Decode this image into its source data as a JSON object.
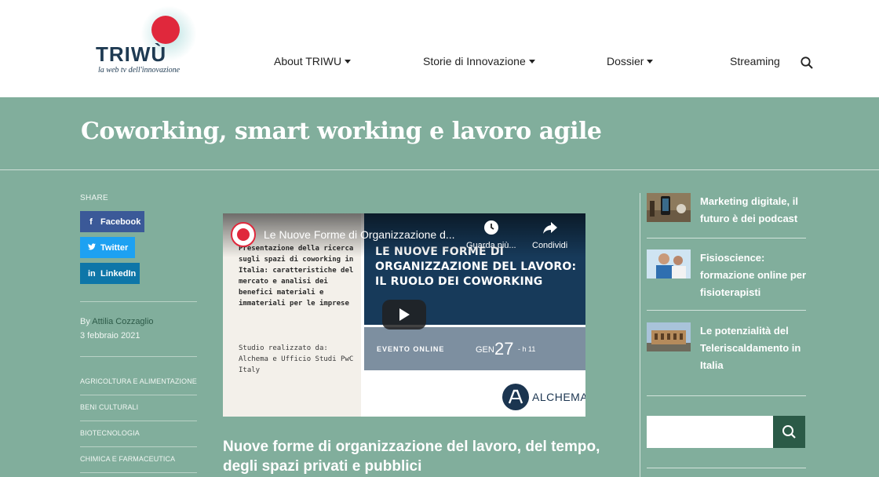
{
  "brand": {
    "name": "TRIWÙ",
    "tagline": "la web tv dell'innovazione"
  },
  "nav": {
    "items": [
      {
        "label": "About TRIWU",
        "has_dropdown": true
      },
      {
        "label": "Storie di Innovazione",
        "has_dropdown": true
      },
      {
        "label": "Dossier",
        "has_dropdown": true
      },
      {
        "label": "Streaming",
        "has_dropdown": false
      }
    ],
    "search_icon": "search-icon"
  },
  "page": {
    "title": "Coworking, smart working e lavoro agile"
  },
  "share": {
    "label": "SHARE",
    "buttons": [
      {
        "label": "Facebook",
        "icon": "f",
        "color": "#3b5998"
      },
      {
        "label": "Twitter",
        "icon": "twitter-icon",
        "color": "#1da1f2"
      },
      {
        "label": "LinkedIn",
        "icon": "in",
        "color": "#0e76a8"
      }
    ]
  },
  "meta": {
    "by": "By",
    "author": "Attilia Cozzaglio",
    "date": "3 febbraio 2021"
  },
  "categories": [
    "AGRICOLTURA E ALIMENTAZIONE",
    "BENI CULTURALI",
    "BIOTECNOLOGIA",
    "CHIMICA E FARMACEUTICA"
  ],
  "video": {
    "title": "Le Nuove Forme di Organizzazione d...",
    "watch_later": "Guarda più...",
    "share": "Condividi",
    "slide_left_text": "Presentazione della ricerca sugli spazi di coworking in Italia: caratteristiche del mercato e analisi dei benefici materiali e immateriali per le imprese",
    "slide_left_credit": "Studio realizzato da: Alchema e Ufficio Studi PwC Italy",
    "slide_headline": "LE NUOVE FORME DI ORGANIZZAZIONE DEL LAVORO: IL RUOLO DEI COWORKING",
    "event_label": "EVENTO ONLINE",
    "event_month": "GEN",
    "event_day": "27",
    "event_time": "- h 11",
    "brand": "ALCHEMA"
  },
  "article": {
    "heading": "Nuove forme di organizzazione del lavoro, del tempo, degli spazi privati e pubblici"
  },
  "related": [
    {
      "title": "Marketing digitale, il futuro è dei podcast"
    },
    {
      "title": "Fisioscience: formazione online per fisioterapisti"
    },
    {
      "title": "Le potenzialità del Teleriscaldamento in Italia"
    }
  ],
  "sidebar_search": {
    "placeholder": ""
  },
  "colors": {
    "background": "#81ae9c",
    "accent": "#2b5a47",
    "brand_red": "#e0283c",
    "brand_navy": "#1e3a52"
  }
}
